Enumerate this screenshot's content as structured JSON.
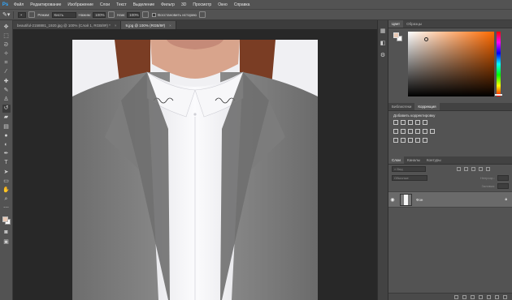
{
  "app": {
    "logo": "Ps"
  },
  "menu": [
    "Файл",
    "Редактирование",
    "Изображение",
    "Слои",
    "Текст",
    "Выделение",
    "Фильтр",
    "3D",
    "Просмотр",
    "Окно",
    "Справка"
  ],
  "options": {
    "mode_label": "Режим:",
    "mode_value": "Кисть",
    "pressure_label": "Нажим:",
    "pressure_value": "100%",
    "flow_label": "Наж:",
    "flow_value": "100%",
    "history_label": "Восстановить историю"
  },
  "doc_tabs": [
    {
      "label": "beautiful-2158881_1920.jpg @ 100% (Слой 1, RGB/8#) *",
      "active": false
    },
    {
      "label": "9.jpg @ 100% (RGB/8#)",
      "active": true
    }
  ],
  "color_panel": {
    "tabs": [
      "Цвет",
      "Образцы"
    ],
    "foreground": "#e8c9b5",
    "background": "#ffffff"
  },
  "adjustments_panel": {
    "tabs": [
      "Библиотеки",
      "Коррекция"
    ],
    "title": "Добавить корректировку"
  },
  "layers_panel": {
    "tabs": [
      "Слои",
      "Каналы",
      "Контуры"
    ],
    "filter_placeholder": "Вид",
    "blend_mode": "Обычные",
    "opacity_label": "Непрозр.:",
    "fill_label": "Заливка:",
    "layer_name": "Фон"
  }
}
